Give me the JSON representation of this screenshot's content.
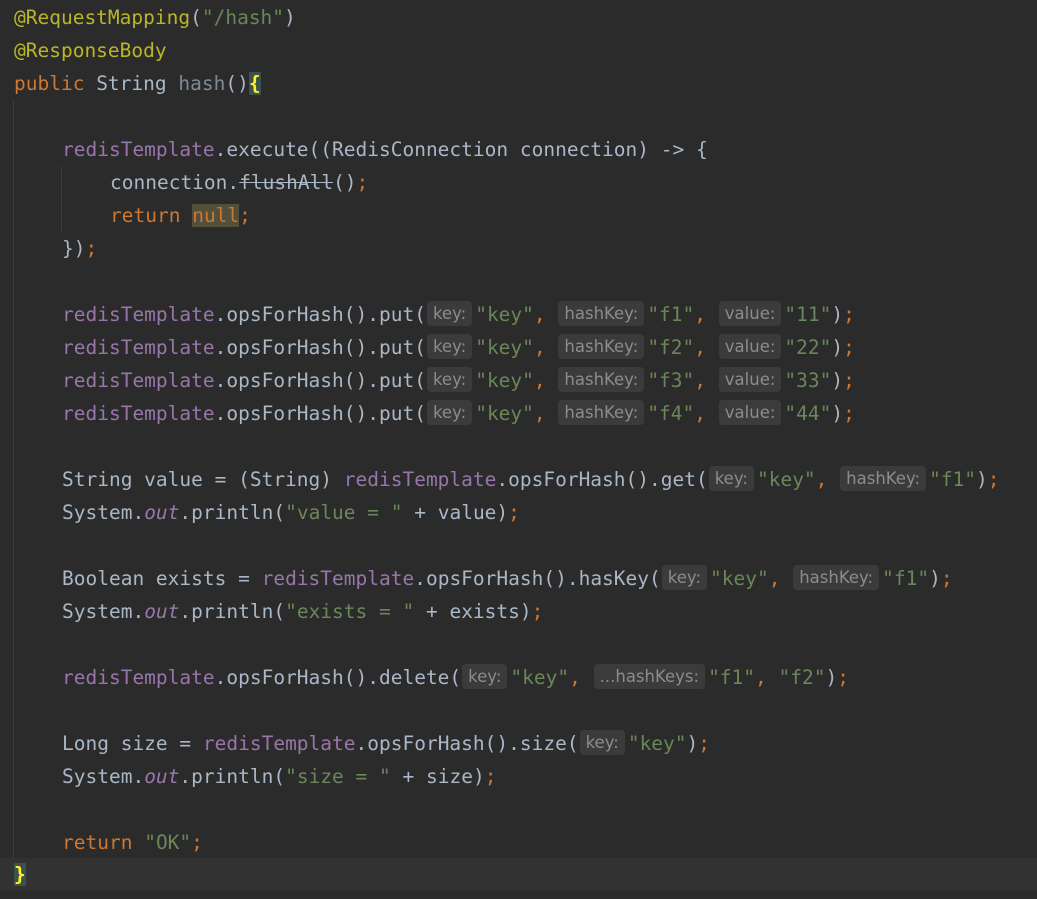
{
  "colors": {
    "background": "#2b2b2b",
    "annotation": "#bbb529",
    "keyword": "#cc7832",
    "string": "#6a8759",
    "field": "#9876aa",
    "text": "#a9b7c6",
    "hint_bg": "#3b3b3b",
    "hint_text": "#8c8c8c"
  },
  "code": {
    "l1": {
      "annotation": "@RequestMapping",
      "open": "(",
      "path": "\"/hash\"",
      "close": ")"
    },
    "l2": {
      "annotation": "@ResponseBody"
    },
    "l3": {
      "kw": "public",
      "type": " String ",
      "name": "hash",
      "parens": "()",
      "brace": "{"
    },
    "l5": {
      "field": "redisTemplate",
      "rest": ".execute((RedisConnection connection) -> {"
    },
    "l6": {
      "obj": "connection.",
      "method": "flushAll",
      "call": "()",
      "semi": ";"
    },
    "l7": {
      "kw": "return",
      "space": " ",
      "nul": "null",
      "semi": ";"
    },
    "l8": {
      "close": "})",
      "semi": ";"
    },
    "put_rows": [
      {
        "field": "redisTemplate",
        "call": ".opsForHash().put(",
        "hint_key": "key:",
        "key": "\"key\"",
        "comma1": ",",
        "hint_hashkey": "hashKey:",
        "hashkey": "\"f1\"",
        "comma2": ",",
        "hint_value": "value:",
        "value": "\"11\"",
        "close": ")",
        "semi": ";"
      },
      {
        "field": "redisTemplate",
        "call": ".opsForHash().put(",
        "hint_key": "key:",
        "key": "\"key\"",
        "comma1": ",",
        "hint_hashkey": "hashKey:",
        "hashkey": "\"f2\"",
        "comma2": ",",
        "hint_value": "value:",
        "value": "\"22\"",
        "close": ")",
        "semi": ";"
      },
      {
        "field": "redisTemplate",
        "call": ".opsForHash().put(",
        "hint_key": "key:",
        "key": "\"key\"",
        "comma1": ",",
        "hint_hashkey": "hashKey:",
        "hashkey": "\"f3\"",
        "comma2": ",",
        "hint_value": "value:",
        "value": "\"33\"",
        "close": ")",
        "semi": ";"
      },
      {
        "field": "redisTemplate",
        "call": ".opsForHash().put(",
        "hint_key": "key:",
        "key": "\"key\"",
        "comma1": ",",
        "hint_hashkey": "hashKey:",
        "hashkey": "\"f4\"",
        "comma2": ",",
        "hint_value": "value:",
        "value": "\"44\"",
        "close": ")",
        "semi": ";"
      }
    ],
    "l15": {
      "decl": "String value = (String) ",
      "field": "redisTemplate",
      "call": ".opsForHash().get(",
      "hint_key": "key:",
      "key": "\"key\"",
      "comma": ",",
      "hint_hashkey": "hashKey:",
      "hashkey": "\"f1\"",
      "close": ")",
      "semi": ";"
    },
    "l16": {
      "sys": "System.",
      "out": "out",
      "call": ".println(",
      "str": "\"value = \"",
      "rest": " + value)",
      "semi": ";"
    },
    "l18": {
      "decl": "Boolean exists = ",
      "field": "redisTemplate",
      "call": ".opsForHash().hasKey(",
      "hint_key": "key:",
      "key": "\"key\"",
      "comma": ",",
      "hint_hashkey": "hashKey:",
      "hashkey": "\"f1\"",
      "close": ")",
      "semi": ";"
    },
    "l19": {
      "sys": "System.",
      "out": "out",
      "call": ".println(",
      "str": "\"exists = \"",
      "rest": " + exists)",
      "semi": ";"
    },
    "l21": {
      "field": "redisTemplate",
      "call": ".opsForHash().delete(",
      "hint_key": "key:",
      "key": "\"key\"",
      "comma1": ",",
      "hint_hashkeys": "...hashKeys:",
      "hk1": "\"f1\"",
      "comma2": ",",
      "hk2": "\"f2\"",
      "close": ")",
      "semi": ";"
    },
    "l23": {
      "decl": "Long size = ",
      "field": "redisTemplate",
      "call": ".opsForHash().size(",
      "hint_key": "key:",
      "key": "\"key\"",
      "close": ")",
      "semi": ";"
    },
    "l24": {
      "sys": "System.",
      "out": "out",
      "call": ".println(",
      "str": "\"size = \"",
      "rest": " + size)",
      "semi": ";"
    },
    "l26": {
      "kw": "return",
      "space": " ",
      "str": "\"OK\"",
      "semi": ";"
    },
    "l27": {
      "brace": "}"
    }
  }
}
